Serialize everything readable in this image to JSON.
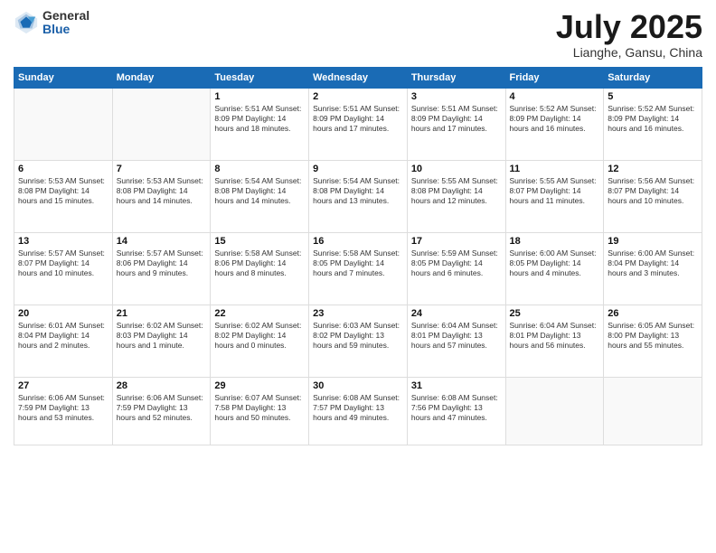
{
  "logo": {
    "general": "General",
    "blue": "Blue"
  },
  "header": {
    "month": "July 2025",
    "location": "Lianghe, Gansu, China"
  },
  "weekdays": [
    "Sunday",
    "Monday",
    "Tuesday",
    "Wednesday",
    "Thursday",
    "Friday",
    "Saturday"
  ],
  "weeks": [
    [
      {
        "day": "",
        "info": ""
      },
      {
        "day": "",
        "info": ""
      },
      {
        "day": "1",
        "info": "Sunrise: 5:51 AM\nSunset: 8:09 PM\nDaylight: 14 hours and 18 minutes."
      },
      {
        "day": "2",
        "info": "Sunrise: 5:51 AM\nSunset: 8:09 PM\nDaylight: 14 hours and 17 minutes."
      },
      {
        "day": "3",
        "info": "Sunrise: 5:51 AM\nSunset: 8:09 PM\nDaylight: 14 hours and 17 minutes."
      },
      {
        "day": "4",
        "info": "Sunrise: 5:52 AM\nSunset: 8:09 PM\nDaylight: 14 hours and 16 minutes."
      },
      {
        "day": "5",
        "info": "Sunrise: 5:52 AM\nSunset: 8:09 PM\nDaylight: 14 hours and 16 minutes."
      }
    ],
    [
      {
        "day": "6",
        "info": "Sunrise: 5:53 AM\nSunset: 8:08 PM\nDaylight: 14 hours and 15 minutes."
      },
      {
        "day": "7",
        "info": "Sunrise: 5:53 AM\nSunset: 8:08 PM\nDaylight: 14 hours and 14 minutes."
      },
      {
        "day": "8",
        "info": "Sunrise: 5:54 AM\nSunset: 8:08 PM\nDaylight: 14 hours and 14 minutes."
      },
      {
        "day": "9",
        "info": "Sunrise: 5:54 AM\nSunset: 8:08 PM\nDaylight: 14 hours and 13 minutes."
      },
      {
        "day": "10",
        "info": "Sunrise: 5:55 AM\nSunset: 8:08 PM\nDaylight: 14 hours and 12 minutes."
      },
      {
        "day": "11",
        "info": "Sunrise: 5:55 AM\nSunset: 8:07 PM\nDaylight: 14 hours and 11 minutes."
      },
      {
        "day": "12",
        "info": "Sunrise: 5:56 AM\nSunset: 8:07 PM\nDaylight: 14 hours and 10 minutes."
      }
    ],
    [
      {
        "day": "13",
        "info": "Sunrise: 5:57 AM\nSunset: 8:07 PM\nDaylight: 14 hours and 10 minutes."
      },
      {
        "day": "14",
        "info": "Sunrise: 5:57 AM\nSunset: 8:06 PM\nDaylight: 14 hours and 9 minutes."
      },
      {
        "day": "15",
        "info": "Sunrise: 5:58 AM\nSunset: 8:06 PM\nDaylight: 14 hours and 8 minutes."
      },
      {
        "day": "16",
        "info": "Sunrise: 5:58 AM\nSunset: 8:05 PM\nDaylight: 14 hours and 7 minutes."
      },
      {
        "day": "17",
        "info": "Sunrise: 5:59 AM\nSunset: 8:05 PM\nDaylight: 14 hours and 6 minutes."
      },
      {
        "day": "18",
        "info": "Sunrise: 6:00 AM\nSunset: 8:05 PM\nDaylight: 14 hours and 4 minutes."
      },
      {
        "day": "19",
        "info": "Sunrise: 6:00 AM\nSunset: 8:04 PM\nDaylight: 14 hours and 3 minutes."
      }
    ],
    [
      {
        "day": "20",
        "info": "Sunrise: 6:01 AM\nSunset: 8:04 PM\nDaylight: 14 hours and 2 minutes."
      },
      {
        "day": "21",
        "info": "Sunrise: 6:02 AM\nSunset: 8:03 PM\nDaylight: 14 hours and 1 minute."
      },
      {
        "day": "22",
        "info": "Sunrise: 6:02 AM\nSunset: 8:02 PM\nDaylight: 14 hours and 0 minutes."
      },
      {
        "day": "23",
        "info": "Sunrise: 6:03 AM\nSunset: 8:02 PM\nDaylight: 13 hours and 59 minutes."
      },
      {
        "day": "24",
        "info": "Sunrise: 6:04 AM\nSunset: 8:01 PM\nDaylight: 13 hours and 57 minutes."
      },
      {
        "day": "25",
        "info": "Sunrise: 6:04 AM\nSunset: 8:01 PM\nDaylight: 13 hours and 56 minutes."
      },
      {
        "day": "26",
        "info": "Sunrise: 6:05 AM\nSunset: 8:00 PM\nDaylight: 13 hours and 55 minutes."
      }
    ],
    [
      {
        "day": "27",
        "info": "Sunrise: 6:06 AM\nSunset: 7:59 PM\nDaylight: 13 hours and 53 minutes."
      },
      {
        "day": "28",
        "info": "Sunrise: 6:06 AM\nSunset: 7:59 PM\nDaylight: 13 hours and 52 minutes."
      },
      {
        "day": "29",
        "info": "Sunrise: 6:07 AM\nSunset: 7:58 PM\nDaylight: 13 hours and 50 minutes."
      },
      {
        "day": "30",
        "info": "Sunrise: 6:08 AM\nSunset: 7:57 PM\nDaylight: 13 hours and 49 minutes."
      },
      {
        "day": "31",
        "info": "Sunrise: 6:08 AM\nSunset: 7:56 PM\nDaylight: 13 hours and 47 minutes."
      },
      {
        "day": "",
        "info": ""
      },
      {
        "day": "",
        "info": ""
      }
    ]
  ]
}
